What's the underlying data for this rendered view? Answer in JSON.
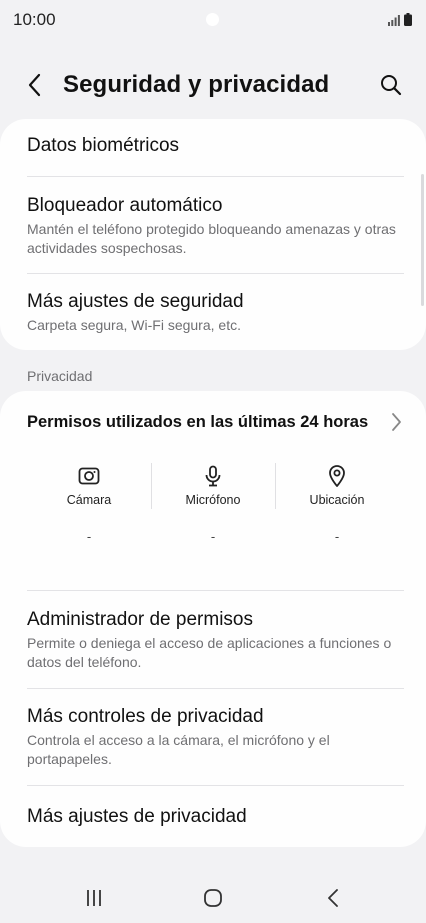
{
  "status_bar": {
    "time": "10:00"
  },
  "app_bar": {
    "title": "Seguridad y privacidad"
  },
  "security_items": [
    {
      "title": "Datos biométricos",
      "subtitle": ""
    },
    {
      "title": "Bloqueador automático",
      "subtitle": "Mantén el teléfono protegido bloqueando amenazas y otras actividades sospechosas."
    },
    {
      "title": "Más ajustes de seguridad",
      "subtitle": "Carpeta segura, Wi-Fi segura, etc."
    }
  ],
  "privacy": {
    "section_label": "Privacidad",
    "permissions_title": "Permisos utilizados en las últimas 24 horas",
    "columns": [
      {
        "label": "Cámara",
        "value": "-",
        "icon": "camera-icon"
      },
      {
        "label": "Micrófono",
        "value": "-",
        "icon": "microphone-icon"
      },
      {
        "label": "Ubicación",
        "value": "-",
        "icon": "location-icon"
      }
    ],
    "items": [
      {
        "title": "Administrador de permisos",
        "subtitle": "Permite o deniega el acceso de aplicaciones a funciones o datos del teléfono."
      },
      {
        "title": "Más controles de privacidad",
        "subtitle": "Controla el acceso a la cámara, el micrófono y el portapapeles."
      },
      {
        "title": "Más ajustes de privacidad",
        "subtitle": ""
      }
    ]
  },
  "nav_bar": {
    "buttons": [
      "recent-apps",
      "home",
      "back"
    ]
  },
  "colors": {
    "background": "#f2f2f4",
    "card": "#fefefe",
    "secondary_text": "#6f6f72"
  }
}
